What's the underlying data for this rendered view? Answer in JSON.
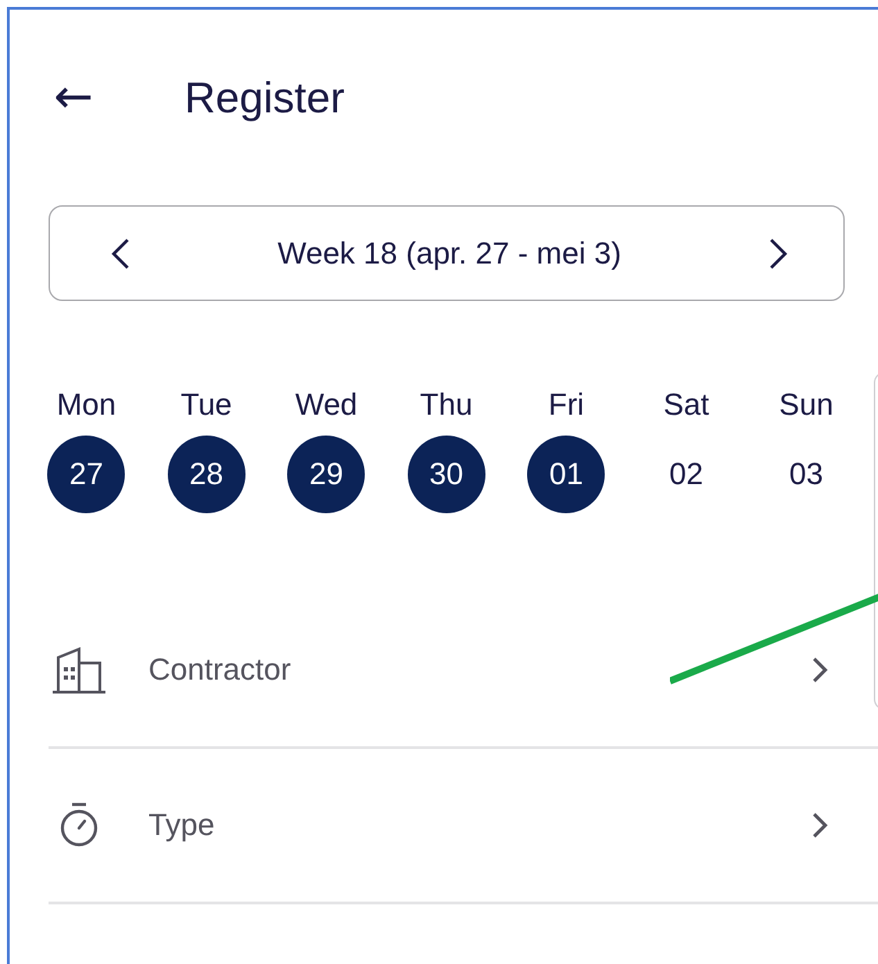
{
  "header": {
    "back_icon": "←",
    "title": "Register"
  },
  "week_selector": {
    "label": "Week 18 (apr. 27 - mei 3)"
  },
  "days": [
    {
      "name": "Mon",
      "date": "27",
      "selected": true
    },
    {
      "name": "Tue",
      "date": "28",
      "selected": true
    },
    {
      "name": "Wed",
      "date": "29",
      "selected": true
    },
    {
      "name": "Thu",
      "date": "30",
      "selected": true
    },
    {
      "name": "Fri",
      "date": "01",
      "selected": true
    },
    {
      "name": "Sat",
      "date": "02",
      "selected": false
    },
    {
      "name": "Sun",
      "date": "03",
      "selected": false
    }
  ],
  "fields": [
    {
      "kind": "building",
      "label": "Contractor"
    },
    {
      "kind": "stopwatch",
      "label": "Type"
    }
  ]
}
